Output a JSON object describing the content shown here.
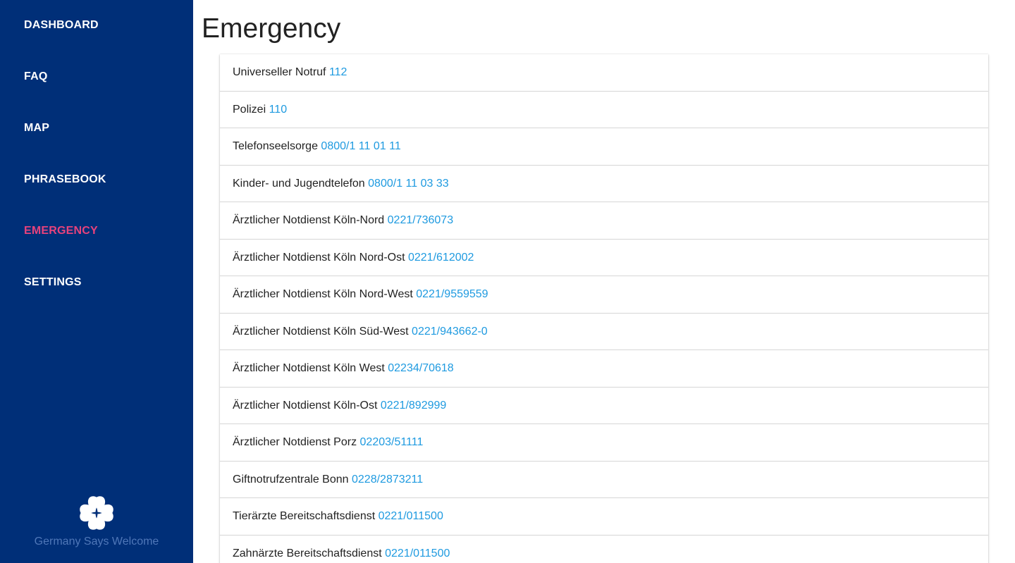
{
  "sidebar": {
    "nav": [
      {
        "label": "DASHBOARD"
      },
      {
        "label": "FAQ"
      },
      {
        "label": "MAP"
      },
      {
        "label": "PHRASEBOOK"
      },
      {
        "label": "EMERGENCY",
        "active": true
      },
      {
        "label": "SETTINGS"
      }
    ],
    "brand": {
      "name": "Germany Says Welcome",
      "icon": "clover-heart-icon"
    }
  },
  "main": {
    "title": "Emergency",
    "contacts": [
      {
        "name": "Universeller Notruf",
        "number": "112"
      },
      {
        "name": "Polizei",
        "number": "110"
      },
      {
        "name": "Telefonseelsorge",
        "number": "0800/1 11 01 11"
      },
      {
        "name": "Kinder- und Jugendtelefon",
        "number": "0800/1 11 03 33"
      },
      {
        "name": "Ärztlicher Notdienst Köln-Nord",
        "number": "0221/736073"
      },
      {
        "name": "Ärztlicher Notdienst Köln Nord-Ost",
        "number": "0221/612002"
      },
      {
        "name": "Ärztlicher Notdienst Köln Nord-West",
        "number": "0221/9559559"
      },
      {
        "name": "Ärztlicher Notdienst Köln Süd-West",
        "number": "0221/943662-0"
      },
      {
        "name": "Ärztlicher Notdienst Köln West",
        "number": "02234/70618"
      },
      {
        "name": "Ärztlicher Notdienst Köln-Ost",
        "number": "0221/892999"
      },
      {
        "name": "Ärztlicher Notdienst Porz",
        "number": "02203/51111"
      },
      {
        "name": "Giftnotrufzentrale Bonn",
        "number": "0228/2873211"
      },
      {
        "name": "Tierärzte Bereitschaftsdienst",
        "number": "0221/011500"
      },
      {
        "name": "Zahnärzte Bereitschaftsdienst",
        "number": "0221/011500"
      }
    ]
  },
  "colors": {
    "sidebar_bg": "#002f78",
    "active_nav": "#e8427c",
    "link": "#1e9ae0",
    "brand_text": "#4f77b8"
  }
}
